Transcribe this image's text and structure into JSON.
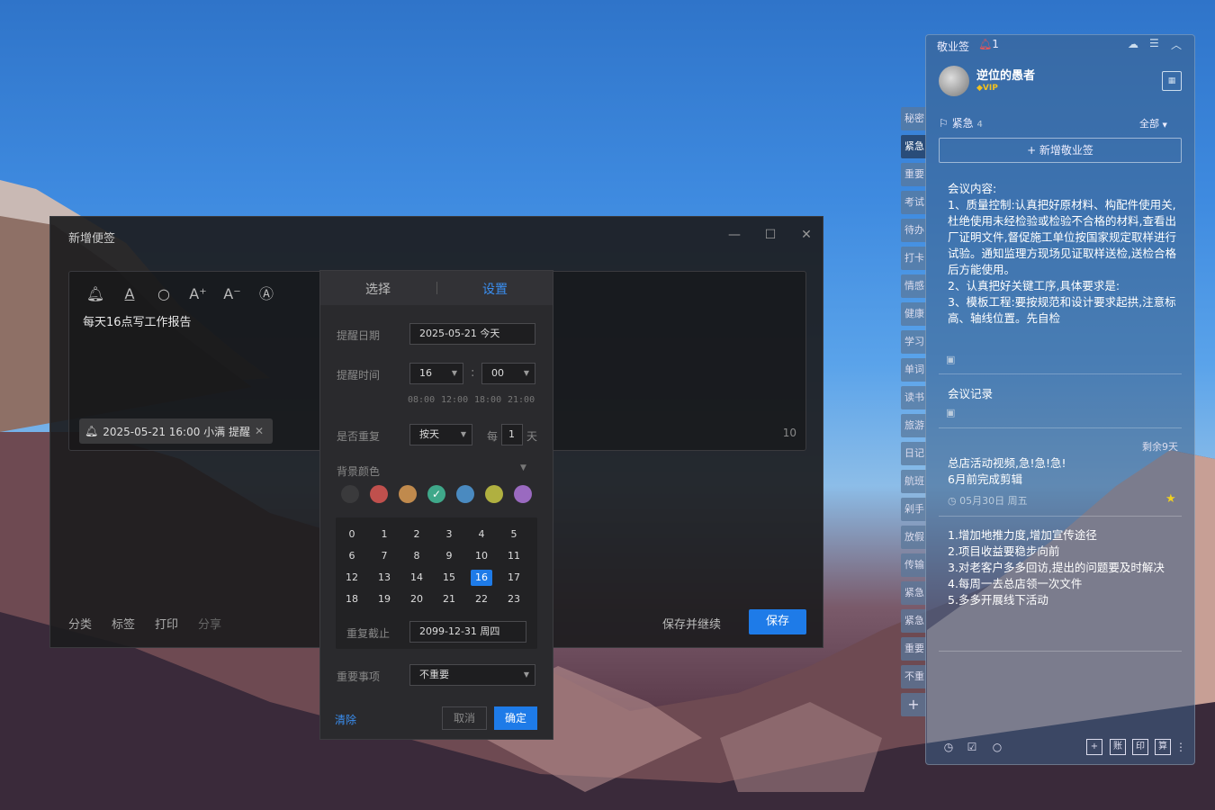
{
  "editor": {
    "title": "新增便签",
    "note_text": "每天16点写工作报告",
    "reminder_chip": "2025-05-21 16:00 小满 提醒",
    "char_count": "10",
    "bottom_links": [
      "分类",
      "标签",
      "打印",
      "分享"
    ],
    "save_continue": "保存并继续",
    "save": "保存"
  },
  "panel": {
    "tab_select": "选择",
    "tab_settings": "设置",
    "remind_date_label": "提醒日期",
    "remind_date_value": "2025-05-21  今天",
    "remind_time_label": "提醒时间",
    "hour_value": "16",
    "minute_value": "00",
    "time_sep": ":",
    "quick_times": [
      "08:00",
      "12:00",
      "18:00",
      "21:00"
    ],
    "repeat_label": "是否重复",
    "repeat_value": "按天",
    "every_label": "每",
    "every_value": "1",
    "every_unit": "天",
    "bg_color_label": "背景颜色",
    "colors": [
      "#3a3a3c",
      "#c0504d",
      "#c08a4d",
      "#3fa88a",
      "#4a8ac0",
      "#b0b040",
      "#9a6ac0"
    ],
    "hours": [
      "0",
      "1",
      "2",
      "3",
      "4",
      "5",
      "6",
      "7",
      "8",
      "9",
      "10",
      "11",
      "12",
      "13",
      "14",
      "15",
      "16",
      "17",
      "18",
      "19",
      "20",
      "21",
      "22",
      "23"
    ],
    "selected_hour": "16",
    "repeat_until_label": "重复截止",
    "repeat_until_value": "2099-12-31  周四",
    "importance_label": "重要事项",
    "importance_value": "不重要",
    "clear": "清除",
    "cancel": "取消",
    "confirm": "确定"
  },
  "sticky": {
    "app_name": "敬业签",
    "notif_count": "1",
    "username": "逆位的愚者",
    "vip": "VIP",
    "category": "紧急",
    "category_count": "4",
    "filter": "全部",
    "new_note": "+ 新增敬业签",
    "side_tabs": [
      "秘密",
      "紧急",
      "重要",
      "考试",
      "待办",
      "打卡",
      "情感",
      "健康",
      "学习",
      "单词",
      "读书",
      "旅游",
      "日记",
      "航班",
      "剁手",
      "放假",
      "传输",
      "紧急",
      "紧急",
      "重要",
      "不重"
    ],
    "note1": "会议内容:\n1、质量控制:认真把好原材料、构配件使用关,杜绝使用未经检验或检验不合格的材料,查看出厂证明文件,督促施工单位按国家规定取样进行试验。通知监理方现场见证取样送检,送检合格后方能使用。\n2、认真把好关键工序,具体要求是:\n3、模板工程:要按规范和设计要求起拱,注意标高、轴线位置。先自检",
    "note2": "会议记录",
    "note3_remaining": "剩余9天",
    "note3": "总店活动视频,急!急!急!\n6月前完成剪辑",
    "note3_date": "05月30日 周五",
    "note4": "1.增加地推力度,增加宣传途径\n2.项目收益要稳步向前\n3.对老客户多多回访,提出的问题要及时解决\n4.每周一去总店领一次文件\n5.多多开展线下活动",
    "bottom_icons": [
      "clock-icon",
      "check-icon",
      "search-icon"
    ],
    "bottom_right": [
      "账",
      "印",
      "算"
    ]
  }
}
